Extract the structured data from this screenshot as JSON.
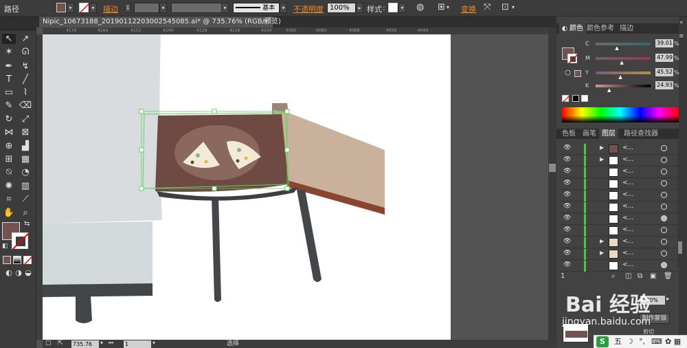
{
  "control_bar": {
    "object_type": "路径",
    "stroke_label": "描边",
    "stroke_profile": "基本",
    "opacity_label": "不透明度",
    "opacity_value": "100%",
    "style_label": "样式",
    "transform_label": "变换"
  },
  "document": {
    "tab_title": "Nipic_10673188_20190112203002545085.ai* @ 735.76% (RGB/预览)",
    "close": "×"
  },
  "ruler": {
    "ticks": [
      "4176",
      "4164",
      "4152",
      "4140",
      "4128",
      "4116",
      "4104",
      "4092",
      "4080",
      "4068",
      "4056",
      "4044"
    ]
  },
  "status_bar": {
    "zoom": "735.76",
    "page": "1",
    "mode": "选择"
  },
  "color_panel": {
    "tabs": [
      "颜色",
      "颜色参考",
      "描边"
    ],
    "active_tab": 0,
    "channels": [
      {
        "label": "C",
        "value": "39.01",
        "pos": 0.39
      },
      {
        "label": "M",
        "value": "47.99",
        "pos": 0.48
      },
      {
        "label": "Y",
        "value": "45.52",
        "pos": 0.455
      },
      {
        "label": "K",
        "value": "24.93",
        "pos": 0.25
      }
    ],
    "percent": "%",
    "fill_color": "#735350",
    "accent": "#f08a24"
  },
  "layers_panel": {
    "tabs": [
      "色板",
      "画笔",
      "图层",
      "路径查找器"
    ],
    "active_tab": 2,
    "rows": [
      {
        "name": "<...",
        "arrow": "▶",
        "target": "empty"
      },
      {
        "name": "<...",
        "arrow": "▶",
        "target": "empty"
      },
      {
        "name": "<...",
        "arrow": "",
        "target": "empty"
      },
      {
        "name": "<...",
        "arrow": "",
        "target": "empty"
      },
      {
        "name": "<...",
        "arrow": "",
        "target": "empty"
      },
      {
        "name": "<...",
        "arrow": "",
        "target": "empty"
      },
      {
        "name": "<...",
        "arrow": "",
        "target": "filled"
      },
      {
        "name": "<...",
        "arrow": "",
        "target": "empty"
      },
      {
        "name": "<...",
        "arrow": "▶",
        "target": "empty"
      },
      {
        "name": "<...",
        "arrow": "▶",
        "target": "empty"
      },
      {
        "name": "<...",
        "arrow": "",
        "target": "filled"
      }
    ],
    "footer_left": "1"
  },
  "transparency_panel": {
    "opacity": "100%",
    "mask_button": "制作蒙版",
    "clip_label": "剪切"
  },
  "watermark": {
    "brand": "Bai 经验",
    "url": "jingyan.baidu.com"
  },
  "ime": {
    "logo": "S",
    "mode": "五",
    "moon": "☽",
    "dot": "°,",
    "keyboard": "⌨",
    "tools": "✿ ▦"
  }
}
